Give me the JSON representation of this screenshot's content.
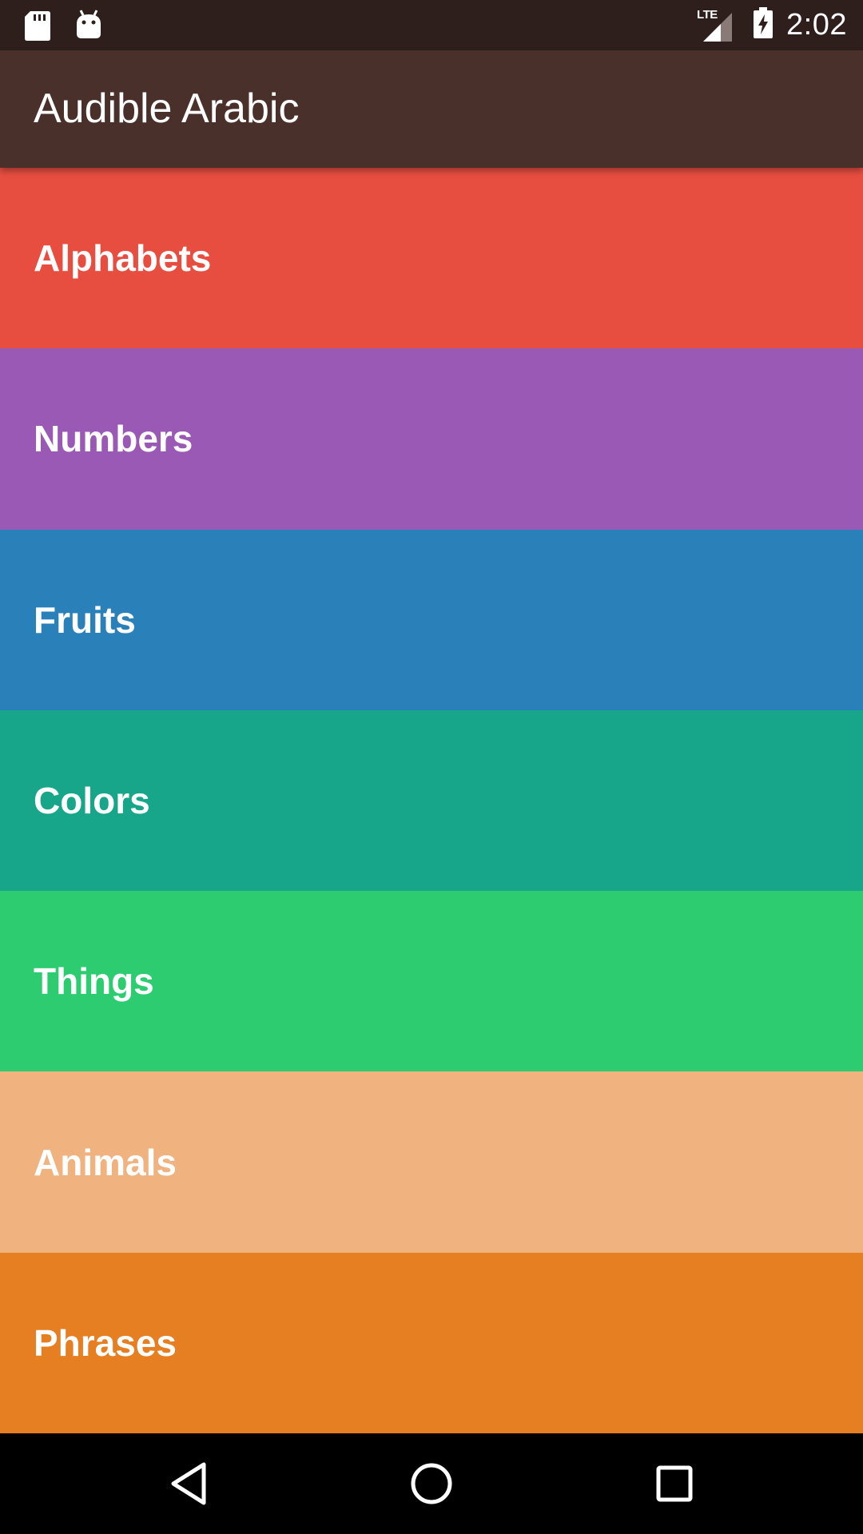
{
  "status_bar": {
    "time": "2:02",
    "network": "LTE",
    "icons": [
      "sd-card-icon",
      "android-debug-icon",
      "lte-signal-icon",
      "battery-charging-icon"
    ]
  },
  "app_bar": {
    "title": "Audible Arabic"
  },
  "categories": [
    {
      "label": "Alphabets",
      "color": "#e84e40"
    },
    {
      "label": "Numbers",
      "color": "#9b59b6"
    },
    {
      "label": "Fruits",
      "color": "#2a80b9"
    },
    {
      "label": "Colors",
      "color": "#17a689"
    },
    {
      "label": "Things",
      "color": "#2ecc71"
    },
    {
      "label": "Animals",
      "color": "#f0b27f"
    },
    {
      "label": "Phrases",
      "color": "#e67e22"
    }
  ],
  "nav_bar": {
    "icons": [
      "back-icon",
      "home-icon",
      "recents-icon"
    ]
  }
}
